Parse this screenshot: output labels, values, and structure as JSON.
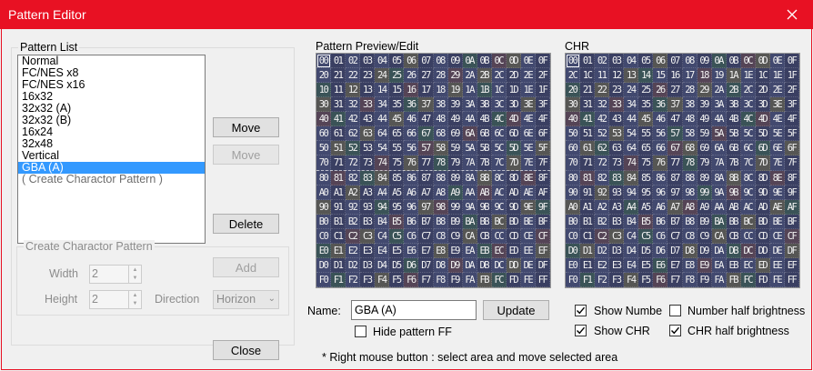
{
  "window": {
    "title": "Pattern Editor"
  },
  "pattern_list": {
    "label": "Pattern List",
    "items": [
      {
        "label": "Normal",
        "state": "normal"
      },
      {
        "label": "FC/NES x8",
        "state": "normal"
      },
      {
        "label": "FC/NES x16",
        "state": "normal"
      },
      {
        "label": "16x32",
        "state": "normal"
      },
      {
        "label": "32x32 (A)",
        "state": "normal"
      },
      {
        "label": "32x32 (B)",
        "state": "normal"
      },
      {
        "label": "16x24",
        "state": "normal"
      },
      {
        "label": "32x48",
        "state": "normal"
      },
      {
        "label": "Vertical",
        "state": "normal"
      },
      {
        "label": "GBA (A)",
        "state": "selected"
      },
      {
        "label": "( Create Charactor Pattern )",
        "state": "dim"
      }
    ],
    "move_up_label": "Move",
    "move_down_label": "Move",
    "delete_label": "Delete"
  },
  "create_pattern": {
    "label": "Create Charactor Pattern",
    "width_label": "Width",
    "width_value": "2",
    "height_label": "Height",
    "height_value": "2",
    "direction_label": "Direction",
    "direction_value": "Horizon",
    "add_label": "Add"
  },
  "close_label": "Close",
  "preview": {
    "label": "Pattern Preview/Edit",
    "cells": [
      "00",
      "01",
      "02",
      "03",
      "04",
      "05",
      "06",
      "07",
      "08",
      "09",
      "0A",
      "0B",
      "0C",
      "0D",
      "0E",
      "0F",
      "20",
      "21",
      "22",
      "23",
      "24",
      "25",
      "26",
      "27",
      "28",
      "29",
      "2A",
      "2B",
      "2C",
      "2D",
      "2E",
      "2F",
      "10",
      "11",
      "12",
      "13",
      "14",
      "15",
      "16",
      "17",
      "18",
      "19",
      "1A",
      "1B",
      "1C",
      "1D",
      "1E",
      "1F",
      "30",
      "31",
      "32",
      "33",
      "34",
      "35",
      "36",
      "37",
      "38",
      "39",
      "3A",
      "3B",
      "3C",
      "3D",
      "3E",
      "3F",
      "40",
      "41",
      "42",
      "43",
      "44",
      "45",
      "46",
      "47",
      "48",
      "49",
      "4A",
      "4B",
      "4C",
      "4D",
      "4E",
      "4F",
      "60",
      "61",
      "62",
      "63",
      "64",
      "65",
      "66",
      "67",
      "68",
      "69",
      "6A",
      "6B",
      "6C",
      "6D",
      "6E",
      "6F",
      "50",
      "51",
      "52",
      "53",
      "54",
      "55",
      "56",
      "57",
      "58",
      "59",
      "5A",
      "5B",
      "5C",
      "5D",
      "5E",
      "5F",
      "70",
      "71",
      "72",
      "73",
      "74",
      "75",
      "76",
      "77",
      "78",
      "79",
      "7A",
      "7B",
      "7C",
      "7D",
      "7E",
      "7F",
      "80",
      "81",
      "82",
      "83",
      "84",
      "85",
      "86",
      "87",
      "88",
      "89",
      "8A",
      "8B",
      "8C",
      "8D",
      "8E",
      "8F",
      "A0",
      "A1",
      "A2",
      "A3",
      "A4",
      "A5",
      "A6",
      "A7",
      "A8",
      "A9",
      "AA",
      "AB",
      "AC",
      "AD",
      "AE",
      "AF",
      "90",
      "91",
      "92",
      "93",
      "94",
      "95",
      "96",
      "97",
      "98",
      "99",
      "9A",
      "9B",
      "9C",
      "9D",
      "9E",
      "9F",
      "B0",
      "B1",
      "B2",
      "B3",
      "B4",
      "B5",
      "B6",
      "B7",
      "B8",
      "B9",
      "BA",
      "BB",
      "BC",
      "BD",
      "BE",
      "BF",
      "C0",
      "C1",
      "C2",
      "C3",
      "C4",
      "C5",
      "C6",
      "C7",
      "C8",
      "C9",
      "CA",
      "CB",
      "CC",
      "CD",
      "CE",
      "CF",
      "E0",
      "E1",
      "E2",
      "E3",
      "E4",
      "E5",
      "E6",
      "E7",
      "E8",
      "E9",
      "EA",
      "EB",
      "EC",
      "ED",
      "EE",
      "EF",
      "D0",
      "D1",
      "D2",
      "D3",
      "D4",
      "D5",
      "D6",
      "D7",
      "D8",
      "D9",
      "DA",
      "DB",
      "DC",
      "DD",
      "DE",
      "DF",
      "F0",
      "F1",
      "F2",
      "F3",
      "F4",
      "F5",
      "F6",
      "F7",
      "F8",
      "F9",
      "FA",
      "FB",
      "FC",
      "FD",
      "FE",
      "FF"
    ]
  },
  "chr": {
    "label": "CHR",
    "cells": [
      "00",
      "01",
      "02",
      "03",
      "04",
      "05",
      "06",
      "07",
      "08",
      "09",
      "0A",
      "0B",
      "0C",
      "0D",
      "0E",
      "0F",
      "2C",
      "1C",
      "11",
      "12",
      "13",
      "14",
      "15",
      "16",
      "17",
      "18",
      "19",
      "1A",
      "1E",
      "1C",
      "1E",
      "1F",
      "20",
      "21",
      "22",
      "23",
      "24",
      "25",
      "26",
      "27",
      "28",
      "29",
      "2A",
      "2B",
      "2C",
      "2D",
      "2E",
      "2F",
      "30",
      "31",
      "32",
      "33",
      "34",
      "35",
      "36",
      "37",
      "38",
      "39",
      "3A",
      "3B",
      "3C",
      "3D",
      "3E",
      "3F",
      "40",
      "41",
      "42",
      "43",
      "44",
      "45",
      "46",
      "47",
      "48",
      "49",
      "4A",
      "4B",
      "4C",
      "4D",
      "4E",
      "4F",
      "50",
      "51",
      "52",
      "53",
      "54",
      "55",
      "56",
      "57",
      "58",
      "59",
      "5A",
      "5B",
      "5C",
      "5D",
      "5E",
      "5F",
      "60",
      "61",
      "62",
      "63",
      "64",
      "65",
      "66",
      "67",
      "68",
      "69",
      "6A",
      "6B",
      "6C",
      "6D",
      "6E",
      "6F",
      "70",
      "71",
      "72",
      "73",
      "74",
      "75",
      "76",
      "77",
      "78",
      "79",
      "7A",
      "7B",
      "7C",
      "7D",
      "7E",
      "7F",
      "80",
      "81",
      "82",
      "83",
      "84",
      "85",
      "86",
      "87",
      "88",
      "89",
      "8A",
      "8B",
      "8C",
      "8D",
      "8E",
      "8F",
      "90",
      "91",
      "92",
      "93",
      "94",
      "95",
      "96",
      "97",
      "98",
      "99",
      "9A",
      "9B",
      "9C",
      "9D",
      "9E",
      "9F",
      "A0",
      "A1",
      "A2",
      "A3",
      "A4",
      "A5",
      "A6",
      "A7",
      "A8",
      "A9",
      "AA",
      "AB",
      "AC",
      "AD",
      "AE",
      "AF",
      "B0",
      "B1",
      "B2",
      "B3",
      "B4",
      "B5",
      "B6",
      "B7",
      "B8",
      "B9",
      "BA",
      "BB",
      "BC",
      "BD",
      "BE",
      "BF",
      "C0",
      "C1",
      "C2",
      "C3",
      "C4",
      "C5",
      "C6",
      "C7",
      "C8",
      "C9",
      "CA",
      "CB",
      "CC",
      "CD",
      "CE",
      "CF",
      "D0",
      "D1",
      "D2",
      "D3",
      "D4",
      "D5",
      "D6",
      "D7",
      "D8",
      "D9",
      "DA",
      "DB",
      "DC",
      "DD",
      "DE",
      "DF",
      "E0",
      "E1",
      "E2",
      "E3",
      "E4",
      "E5",
      "E6",
      "E7",
      "E8",
      "E9",
      "EA",
      "EB",
      "EC",
      "ED",
      "EE",
      "EF",
      "F0",
      "F1",
      "F2",
      "F3",
      "F4",
      "F5",
      "F6",
      "F7",
      "F8",
      "F9",
      "FA",
      "FB",
      "FC",
      "FD",
      "FE",
      "FF"
    ]
  },
  "name_field": {
    "label": "Name:",
    "value": "GBA (A)"
  },
  "update_label": "Update",
  "hide_ff": {
    "label": "Hide pattern FF",
    "checked": false
  },
  "options": {
    "show_number": {
      "label": "Show Numbe",
      "checked": true
    },
    "number_half": {
      "label": "Number half brightness",
      "checked": false
    },
    "show_chr": {
      "label": "Show CHR",
      "checked": true
    },
    "chr_half": {
      "label": "CHR half brightness",
      "checked": true
    }
  },
  "hint": "* Right mouse button : select area and move selected area"
}
